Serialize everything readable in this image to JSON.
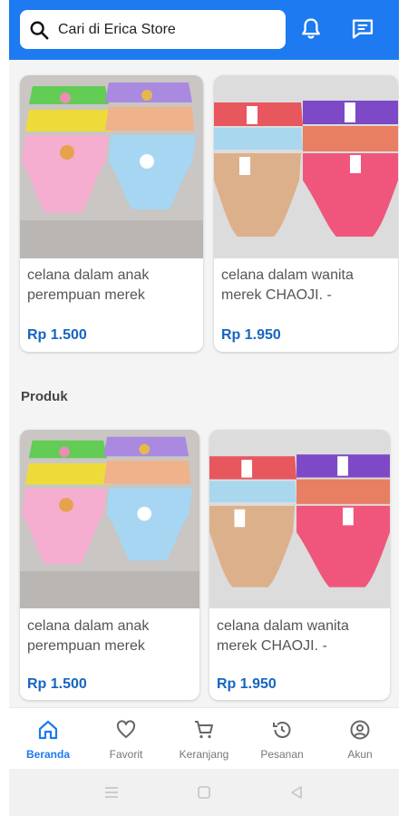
{
  "search": {
    "placeholder": "Cari di Erica Store"
  },
  "header": {
    "icons": [
      "bell-icon",
      "chat-icon"
    ]
  },
  "section": {
    "title": "Produk"
  },
  "products": [
    {
      "name": "celana dalam anak perempuan merek",
      "price": "Rp 1.500"
    },
    {
      "name": "celana dalam wanita merek CHAOJI. -",
      "price": "Rp 1.950"
    },
    {
      "name": "celana dalam anak perempuan merek",
      "price": "Rp 1.500"
    },
    {
      "name": "celana dalam wanita merek CHAOJI. -",
      "price": "Rp 1.950"
    }
  ],
  "nav": {
    "items": [
      {
        "label": "Beranda",
        "icon": "home-icon",
        "active": true
      },
      {
        "label": "Favorit",
        "icon": "heart-icon",
        "active": false
      },
      {
        "label": "Keranjang",
        "icon": "cart-icon",
        "active": false
      },
      {
        "label": "Pesanan",
        "icon": "history-icon",
        "active": false
      },
      {
        "label": "Akun",
        "icon": "account-icon",
        "active": false
      }
    ]
  },
  "colors": {
    "primary": "#1d7af0",
    "price": "#1565c0",
    "background": "#f4f4f4"
  }
}
